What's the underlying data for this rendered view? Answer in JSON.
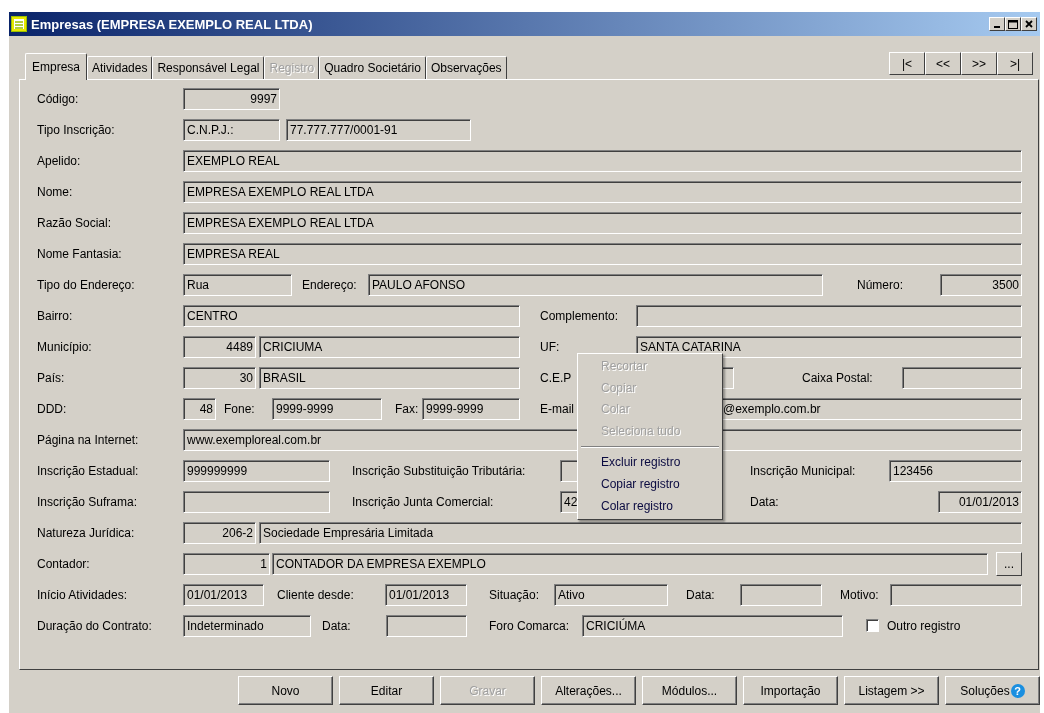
{
  "window": {
    "title": "Empresas (EMPRESA EXEMPLO REAL LTDA)"
  },
  "tabs": [
    {
      "label": "Empresa",
      "selected": true,
      "disabled": false
    },
    {
      "label": "Atividades",
      "selected": false,
      "disabled": false
    },
    {
      "label": "Responsável Legal",
      "selected": false,
      "disabled": false
    },
    {
      "label": "Registro",
      "selected": false,
      "disabled": true
    },
    {
      "label": "Quadro Societário",
      "selected": false,
      "disabled": false
    },
    {
      "label": "Observações",
      "selected": false,
      "disabled": false
    }
  ],
  "record_nav": [
    "|<",
    "<<",
    ">>",
    ">|"
  ],
  "form_rows": [
    {
      "items": [
        {
          "kind": "label",
          "text": "Código:"
        },
        {
          "kind": "field",
          "value": "9997"
        }
      ]
    },
    {
      "items": [
        {
          "kind": "label",
          "text": "Tipo Inscrição:"
        },
        {
          "kind": "field",
          "value": "C.N.P.J.:"
        },
        {
          "kind": "field",
          "value": "77.777.777/0001-91"
        }
      ]
    },
    {
      "items": [
        {
          "kind": "label",
          "text": "Apelido:"
        },
        {
          "kind": "field",
          "value": "EXEMPLO REAL"
        }
      ]
    },
    {
      "items": [
        {
          "kind": "label",
          "text": "Nome:"
        },
        {
          "kind": "field",
          "value": "EMPRESA EXEMPLO REAL LTDA"
        }
      ]
    },
    {
      "items": [
        {
          "kind": "label",
          "text": "Razão Social:"
        },
        {
          "kind": "field",
          "value": "EMPRESA EXEMPLO REAL LTDA"
        }
      ]
    },
    {
      "items": [
        {
          "kind": "label",
          "text": "Nome Fantasia:"
        },
        {
          "kind": "field",
          "value": "EMPRESA REAL"
        }
      ]
    },
    {
      "items": [
        {
          "kind": "label",
          "text": "Tipo do Endereço:"
        },
        {
          "kind": "field",
          "value": "Rua"
        },
        {
          "kind": "label",
          "text": "Endereço:"
        },
        {
          "kind": "field",
          "value": "PAULO AFONSO"
        },
        {
          "kind": "label",
          "text": "Número:"
        },
        {
          "kind": "field",
          "value": "3500"
        }
      ]
    },
    {
      "items": [
        {
          "kind": "label",
          "text": "Bairro:"
        },
        {
          "kind": "field",
          "value": "CENTRO"
        },
        {
          "kind": "label",
          "text": "Complemento:"
        },
        {
          "kind": "field"
        }
      ]
    },
    {
      "items": [
        {
          "kind": "label",
          "text": "Município:"
        },
        {
          "kind": "field",
          "value": "4489"
        },
        {
          "kind": "field",
          "value": "CRICIUMA"
        },
        {
          "kind": "label",
          "text": "UF:"
        },
        {
          "kind": "field",
          "value": "SANTA CATARINA"
        }
      ]
    },
    {
      "items": [
        {
          "kind": "label",
          "text": "País:"
        },
        {
          "kind": "field",
          "value": "30"
        },
        {
          "kind": "field",
          "value": "BRASIL"
        },
        {
          "kind": "label",
          "text": "C.E.P"
        },
        {
          "kind": "field"
        },
        {
          "kind": "label",
          "text": "Caixa Postal:"
        },
        {
          "kind": "field"
        }
      ]
    },
    {
      "items": [
        {
          "kind": "label",
          "text": "DDD:"
        },
        {
          "kind": "field",
          "value": "48"
        },
        {
          "kind": "label",
          "text": "Fone:"
        },
        {
          "kind": "field",
          "value": "9999-9999"
        },
        {
          "kind": "label",
          "text": "Fax:"
        },
        {
          "kind": "field",
          "value": "9999-9999"
        },
        {
          "kind": "label",
          "text": "E-mail"
        },
        {
          "kind": "field",
          "value": "@exemplo.com.br"
        }
      ]
    },
    {
      "items": [
        {
          "kind": "label",
          "text": "Página na Internet:"
        },
        {
          "kind": "field",
          "value": "www.exemploreal.com.br"
        }
      ]
    },
    {
      "items": [
        {
          "kind": "label",
          "text": "Inscrição Estadual:"
        },
        {
          "kind": "field",
          "value": "999999999"
        },
        {
          "kind": "label",
          "text": "Inscrição Substituição Tributária:"
        },
        {
          "kind": "field"
        },
        {
          "kind": "label",
          "text": "Inscrição Municipal:"
        },
        {
          "kind": "field",
          "value": "123456"
        }
      ]
    },
    {
      "items": [
        {
          "kind": "label",
          "text": "Inscrição Suframa:"
        },
        {
          "kind": "field"
        },
        {
          "kind": "label",
          "text": "Inscrição Junta Comercial:"
        },
        {
          "kind": "field",
          "value": "42"
        },
        {
          "kind": "label",
          "text": "Data:"
        },
        {
          "kind": "field",
          "value": "01/01/2013"
        }
      ]
    },
    {
      "items": [
        {
          "kind": "label",
          "text": "Natureza Jurídica:"
        },
        {
          "kind": "field",
          "value": "206-2"
        },
        {
          "kind": "field",
          "value": "Sociedade Empresária Limitada"
        }
      ]
    },
    {
      "items": [
        {
          "kind": "label",
          "text": "Contador:"
        },
        {
          "kind": "field",
          "value": "1"
        },
        {
          "kind": "field",
          "value": "CONTADOR DA EMPRESA EXEMPLO"
        },
        {
          "kind": "button",
          "text": "..."
        }
      ]
    },
    {
      "items": [
        {
          "kind": "label",
          "text": "Início Atividades:"
        },
        {
          "kind": "field",
          "value": "01/01/2013"
        },
        {
          "kind": "label",
          "text": "Cliente desde:"
        },
        {
          "kind": "field",
          "value": "01/01/2013"
        },
        {
          "kind": "label",
          "text": "Situação:"
        },
        {
          "kind": "field",
          "value": "Ativo"
        },
        {
          "kind": "label",
          "text": "Data:"
        },
        {
          "kind": "field"
        },
        {
          "kind": "label",
          "text": "Motivo:"
        },
        {
          "kind": "field"
        }
      ]
    },
    {
      "items": [
        {
          "kind": "label",
          "text": "Duração do Contrato:"
        },
        {
          "kind": "field",
          "value": "Indeterminado"
        },
        {
          "kind": "label",
          "text": "Data:"
        },
        {
          "kind": "field"
        },
        {
          "kind": "label",
          "text": "Foro Comarca:"
        },
        {
          "kind": "field",
          "value": "CRICIÚMA"
        },
        {
          "kind": "checkbox",
          "text": "Outro registro",
          "checked": false
        }
      ]
    }
  ],
  "context_menu": [
    {
      "kind": "item",
      "label": "Recortar",
      "disabled": true
    },
    {
      "kind": "item",
      "label": "Copiar",
      "disabled": true
    },
    {
      "kind": "item",
      "label": "Colar",
      "disabled": true
    },
    {
      "kind": "item",
      "label": "Seleciona tudo",
      "disabled": true
    },
    {
      "kind": "separator"
    },
    {
      "kind": "item",
      "label": "Excluir registro",
      "disabled": false
    },
    {
      "kind": "item",
      "label": "Copiar registro",
      "disabled": false
    },
    {
      "kind": "item",
      "label": "Colar registro",
      "disabled": false
    }
  ],
  "buttons": [
    {
      "label": "Novo",
      "disabled": false
    },
    {
      "label": "Editar",
      "disabled": false
    },
    {
      "label": "Gravar",
      "disabled": true
    },
    {
      "label": "Alterações...",
      "disabled": false
    },
    {
      "label": "Módulos...",
      "disabled": false
    },
    {
      "label": "Importação",
      "disabled": false
    },
    {
      "label": "Listagem >>",
      "disabled": false
    },
    {
      "label": "Soluções",
      "disabled": false,
      "help_icon": "?"
    }
  ]
}
